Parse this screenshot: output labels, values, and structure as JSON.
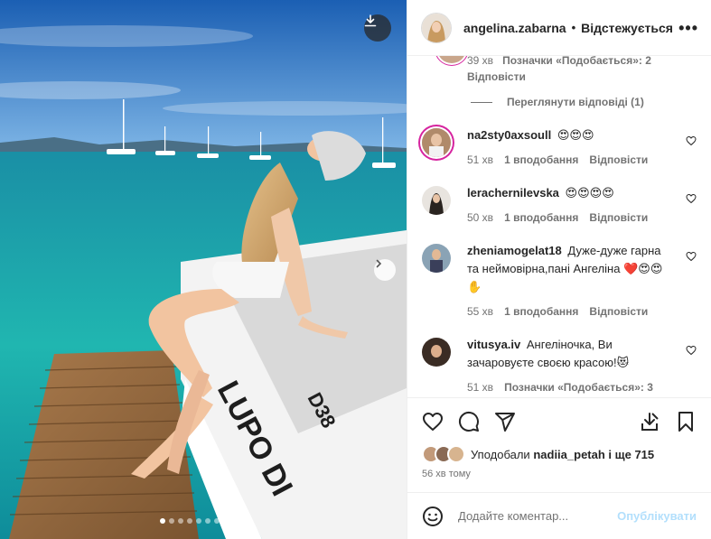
{
  "header": {
    "username": "angelina.zabarna",
    "separator": "•",
    "follow_label": "Відстежується",
    "more_label": "•••"
  },
  "partial_comment": {
    "meta_time": "39 хв",
    "meta_likes": "Позначки «Подобається»: 2",
    "reply": "Відповісти"
  },
  "view_replies": "Переглянути відповіді (1)",
  "comments": [
    {
      "user": "na2sty0axsoull",
      "text": "😍😍😍",
      "time": "51 хв",
      "likes": "1 вподобання",
      "reply": "Відповісти"
    },
    {
      "user": "lerachernilevska",
      "text": "😍😍😍😍",
      "time": "50 хв",
      "likes": "1 вподобання",
      "reply": "Відповісти"
    },
    {
      "user": "zheniamogelat18",
      "text": "Дуже-дуже гарна та неймовірна,пані Ангеліна ❤️😍😍✋",
      "time": "55 хв",
      "likes": "1 вподобання",
      "reply": "Відповісти"
    },
    {
      "user": "vitusya.iv",
      "text": "Ангеліночка, Ви зачаровуєте своєю красою!😻",
      "time": "51 хв",
      "likes": "Позначки «Подобається»: 3",
      "reply": ""
    }
  ],
  "likes": {
    "prefix": "Уподобали",
    "user": "nadiia_petah",
    "suffix": "і ще 715"
  },
  "post_time": "56 хв тому",
  "add_comment": {
    "placeholder": "Додайте коментар...",
    "post_label": "Опублікувати"
  },
  "colors": {
    "accent": "#0095f6",
    "post_disabled": "#b2dffc",
    "secondary_text": "#737373",
    "like_heart": "#262626"
  },
  "carousel": {
    "total": 10,
    "active": 1
  }
}
